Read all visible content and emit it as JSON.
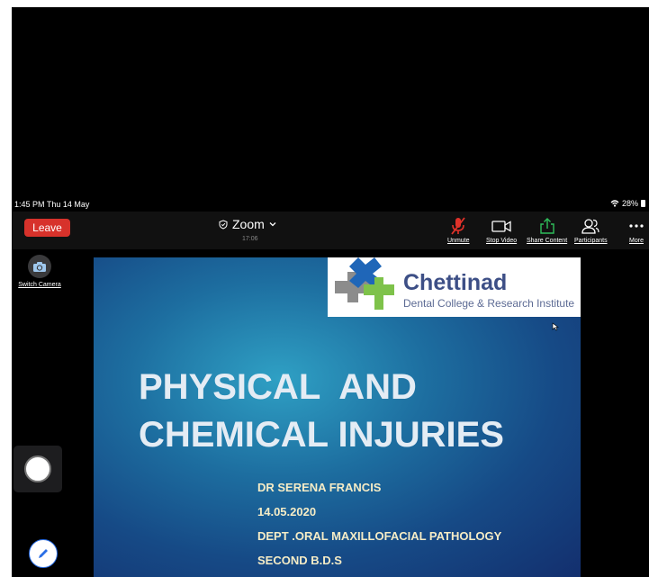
{
  "status_bar": {
    "time": "1:45 PM  Thu 14 May",
    "battery": "28%",
    "wifi_icon": "wifi-icon",
    "battery_icon": "battery-icon"
  },
  "toolbar": {
    "leave_label": "Leave",
    "meeting_title": "Zoom",
    "meeting_timer": "17:06",
    "unmute_label": "Unmute",
    "stop_video_label": "Stop Video",
    "share_content_label": "Share Content",
    "participants_label": "Participants",
    "more_label": "More",
    "colors": {
      "leave": "#d7322b",
      "mic_muted": "#e0322a",
      "share": "#2fbe5b"
    }
  },
  "sidebar": {
    "switch_camera_label": "Switch Camera"
  },
  "slide": {
    "logo_name": "Chettinad",
    "logo_subtitle": "Dental College & Research Institute",
    "title_line1": "PHYSICAL  AND",
    "title_line2": "CHEMICAL INJURIES",
    "presenter": "DR SERENA FRANCIS",
    "date": "14.05.2020",
    "department": "DEPT .ORAL MAXILLOFACIAL PATHOLOGY",
    "year": "SECOND B.D.S"
  }
}
